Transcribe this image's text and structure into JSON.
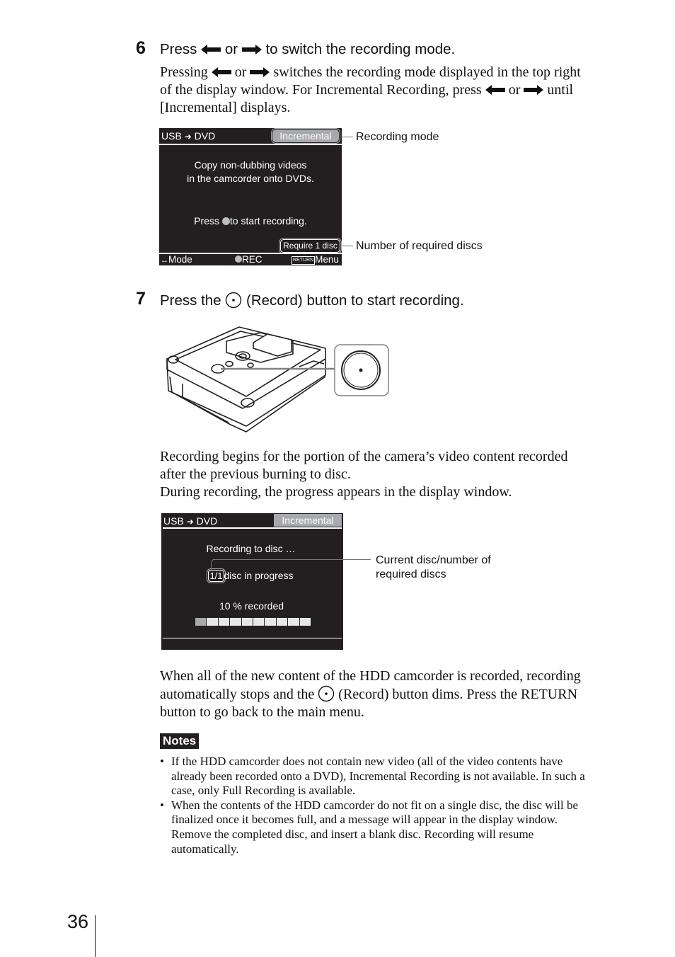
{
  "step6": {
    "number": "6",
    "title_press": "Press",
    "title_or": "or",
    "title_rest": "to switch the recording mode.",
    "body_line1_a": "Pressing",
    "body_line1_or": "or",
    "body_line1_b": "switches the recording mode displayed in the top right",
    "body_line2_a": "of the display window. For Incremental Recording, press",
    "body_line2_or": "or",
    "body_line2_b": "until",
    "body_line3": "[Incremental] displays.",
    "icons": [
      "left-arrow-icon",
      "right-arrow-icon"
    ]
  },
  "screen1": {
    "source_dest": "USB → DVD",
    "source": "USB",
    "dest": "DVD",
    "mode": "Incremental",
    "message_line1": "Copy non-dubbing videos",
    "message_line2": "in the camcorder onto DVDs.",
    "press_a": "Press",
    "press_b": "to start recording.",
    "require": "Require 1 disc",
    "footer_mode": "Mode",
    "footer_rec": "REC",
    "footer_return": "RETURN",
    "footer_menu": "Menu",
    "callout_mode": "Recording mode",
    "callout_discs": "Number of required discs"
  },
  "step7": {
    "number": "7",
    "title_a": "Press the",
    "title_b": "(Record) button to start recording.",
    "icon": "record-button-icon"
  },
  "paragraph_recording": {
    "line1": "Recording begins for the portion of the camera’s video content recorded",
    "line2": "after the previous burning to disc.",
    "line3": "During recording, the progress appears in the display window."
  },
  "screen2": {
    "source": "USB",
    "dest": "DVD",
    "mode": "Incremental",
    "status": "Recording to disc …",
    "disc_count": "1/1",
    "disc_text": "disc in progress",
    "percent_text": "10 % recorded",
    "progress_percent": 10,
    "progress_segments_total": 10,
    "progress_segments_filled": 1,
    "callout_line1": "Current disc/number of",
    "callout_line2": "required discs"
  },
  "paragraph_finish": {
    "line1": "When all of the new content of the HDD camcorder is recorded, recording",
    "line2_a": "automatically stops and the",
    "line2_b": "(Record) button dims. Press the RETURN",
    "line3": "button to go back to the main menu."
  },
  "notes": {
    "label": "Notes",
    "items": [
      {
        "line1": "If the HDD camcorder does not contain new video (all of the video contents have",
        "line2": "already been recorded onto a DVD), Incremental Recording is not available. In such a",
        "line3": "case, only Full Recording is available."
      },
      {
        "line1": "When the contents of the HDD camcorder do not fit on a single disc, the disc will be",
        "line2": "finalized once it becomes full, and a message will appear in the display window.",
        "line3": "Remove the completed disc, and insert a blank disc. Recording will resume",
        "line4": "automatically."
      }
    ]
  },
  "page_number": "36",
  "colors": {
    "lcd_background": "#231f20",
    "mode_pill": "#a7a9ac",
    "progress_filled": "#a7a9ac",
    "progress_empty": "#e6e7e8"
  }
}
